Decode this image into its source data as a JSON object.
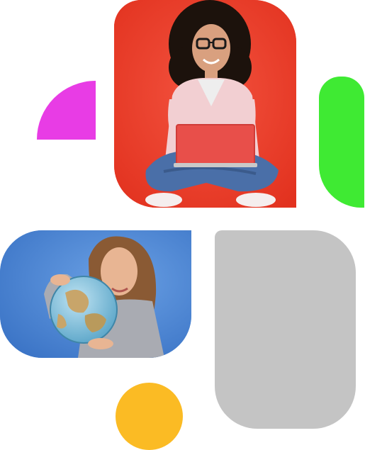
{
  "colors": {
    "magenta": "#e83ce5",
    "red": "#ee3b2c",
    "green": "#3fea33",
    "blue": "#4a86d6",
    "grey": "#c4c4c4",
    "yellow": "#fbbb24"
  },
  "photos": {
    "top": {
      "subject": "woman-with-laptop"
    },
    "bottom": {
      "subject": "woman-holding-globe"
    }
  }
}
